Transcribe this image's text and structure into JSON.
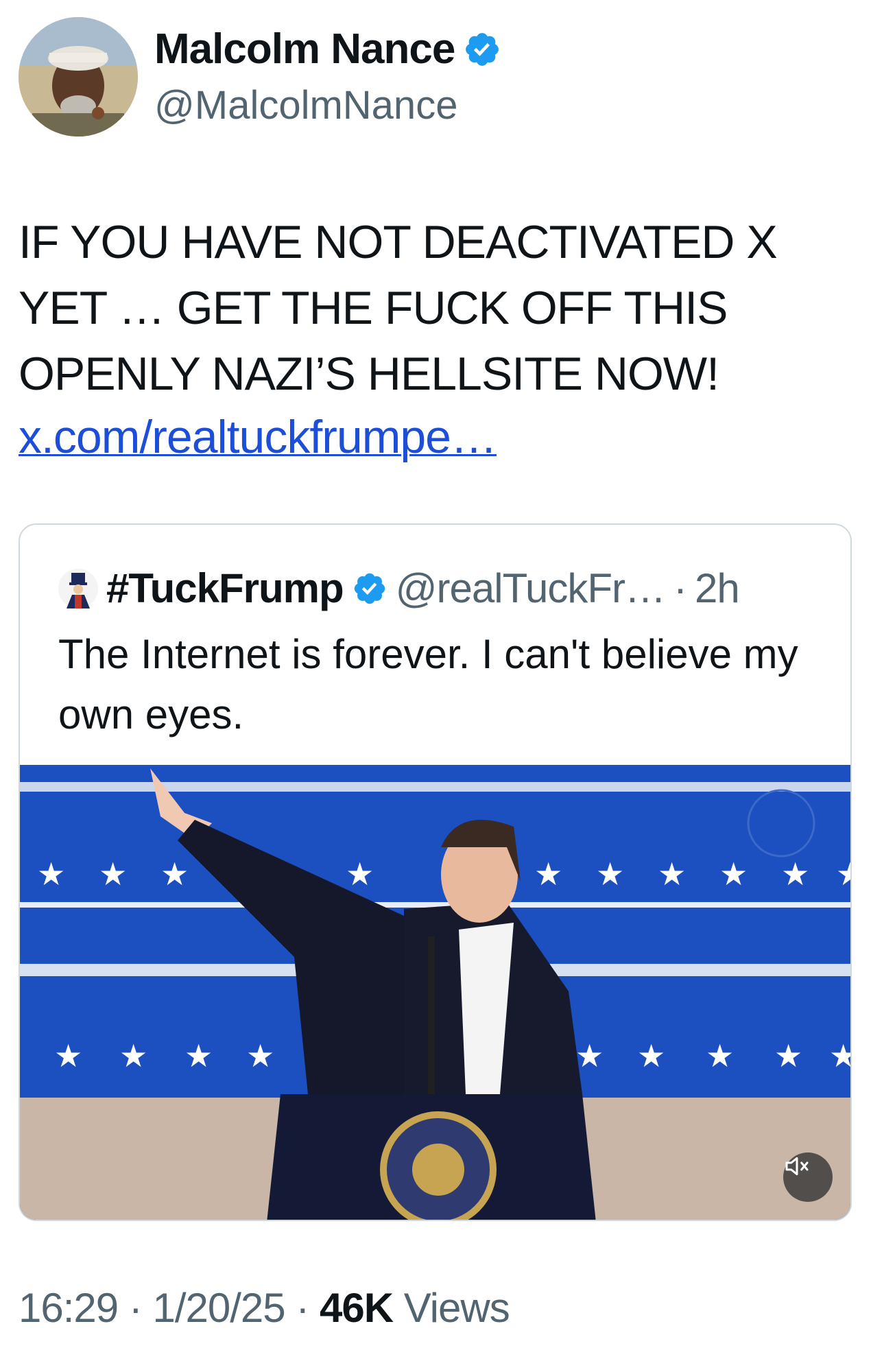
{
  "author": {
    "display_name": "Malcolm Nance",
    "handle": "@MalcolmNance",
    "verified": true,
    "avatar": "profile-photo"
  },
  "tweet": {
    "text": "IF YOU HAVE NOT DEACTIVATED X YET … GET THE FUCK OFF THIS OPENLY NAZI’S HELLSITE NOW!",
    "link": "x.com/realtuckfrumpe…"
  },
  "quoted": {
    "display_name": "#TuckFrump",
    "verified": true,
    "handle": "@realTuckFr…",
    "separator": "·",
    "time_ago": "2h",
    "text": "The Internet is forever. I can't believe my own eyes.",
    "media_icon": "video-mute-icon"
  },
  "meta": {
    "time": "16:29",
    "sep1": " · ",
    "date": "1/20/25",
    "sep2": " · ",
    "views_count": "46K",
    "views_label": " Views"
  },
  "colors": {
    "verified_blue": "#1d9bf0",
    "link_blue": "#1d4ed8",
    "secondary_text": "#536471"
  }
}
